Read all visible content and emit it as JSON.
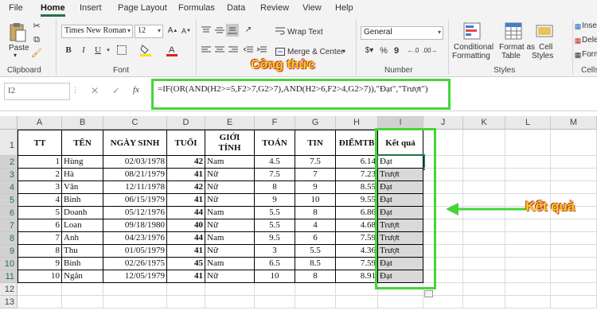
{
  "tabs": [
    "File",
    "Home",
    "Insert",
    "Page Layout",
    "Formulas",
    "Data",
    "Review",
    "View",
    "Help"
  ],
  "ribbon": {
    "paste": "Paste",
    "clipboard": "Clipboard",
    "font_name": "Times New Roman",
    "font_size": "12",
    "font_group": "Font",
    "bold": "B",
    "italic": "I",
    "underline": "U",
    "wrap_text": "Wrap Text",
    "merge_center": "Merge & Center",
    "number_format": "General",
    "number_group": "Number",
    "conditional_formatting": [
      "Conditional",
      "Formatting"
    ],
    "format_as_table": [
      "Format as",
      "Table"
    ],
    "cell_styles": [
      "Cell",
      "Styles"
    ],
    "styles_group": "Styles",
    "insert": "Insert",
    "delete": "Delete",
    "format": "Format",
    "cells_group": "Cells",
    "alignment_label": "Công thức",
    "accent": "#217346"
  },
  "formula_bar": {
    "name_box": "I2",
    "cancel": "✕",
    "enter": "✓",
    "fx": "fx",
    "formula": "=IF(OR(AND(H2>=5,F2>7,G2>7),AND(H2>6,F2>4,G2>7)),\"Đạt\",\"Trượt\")"
  },
  "columns": [
    "A",
    "B",
    "C",
    "D",
    "E",
    "F",
    "G",
    "H",
    "I",
    "J",
    "K",
    "L",
    "M"
  ],
  "rows": [
    "1",
    "2",
    "3",
    "4",
    "5",
    "6",
    "7",
    "8",
    "9",
    "10",
    "11",
    "12",
    "13"
  ],
  "headers": [
    "TT",
    "TÊN",
    "NGÀY SINH",
    "TUỔI",
    "GIỚI TÍNH",
    "TOÁN",
    "TIN",
    "ĐIỂMTB",
    "Kết quả"
  ],
  "header_gioi": [
    "GIỚI",
    "TÍNH"
  ],
  "data": [
    [
      "1",
      "Hùng",
      "02/03/1978",
      "42",
      "Nam",
      "4.5",
      "7.5",
      "6.14",
      "Đạt"
    ],
    [
      "2",
      "Hà",
      "08/21/1979",
      "41",
      "Nữ",
      "7.5",
      "7",
      "7.23",
      "Trượt"
    ],
    [
      "3",
      "Vân",
      "12/11/1978",
      "42",
      "Nữ",
      "8",
      "9",
      "8.55",
      "Đạt"
    ],
    [
      "4",
      "Bình",
      "06/15/1979",
      "41",
      "Nữ",
      "9",
      "10",
      "9.55",
      "Đạt"
    ],
    [
      "5",
      "Doanh",
      "05/12/1976",
      "44",
      "Nam",
      "5.5",
      "8",
      "6.86",
      "Đạt"
    ],
    [
      "6",
      "Loan",
      "09/18/1980",
      "40",
      "Nữ",
      "5.5",
      "4",
      "4.68",
      "Trượt"
    ],
    [
      "7",
      "Anh",
      "04/23/1976",
      "44",
      "Nam",
      "9.5",
      "6",
      "7.59",
      "Trượt"
    ],
    [
      "8",
      "Thu",
      "01/05/1979",
      "41",
      "Nữ",
      "3",
      "5.5",
      "4.36",
      "Trượt"
    ],
    [
      "9",
      "Bình",
      "02/26/1975",
      "45",
      "Nam",
      "6.5",
      "8.5",
      "7.59",
      "Đạt"
    ],
    [
      "10",
      "Ngân",
      "12/05/1979",
      "41",
      "Nữ",
      "10",
      "8",
      "8.91",
      "Đạt"
    ]
  ],
  "annotation_result": "Kết quả",
  "colors": {
    "highlight": "#46d43a",
    "annotation_text": "#f7d11b",
    "selected_fill": "#d9d9d9"
  }
}
